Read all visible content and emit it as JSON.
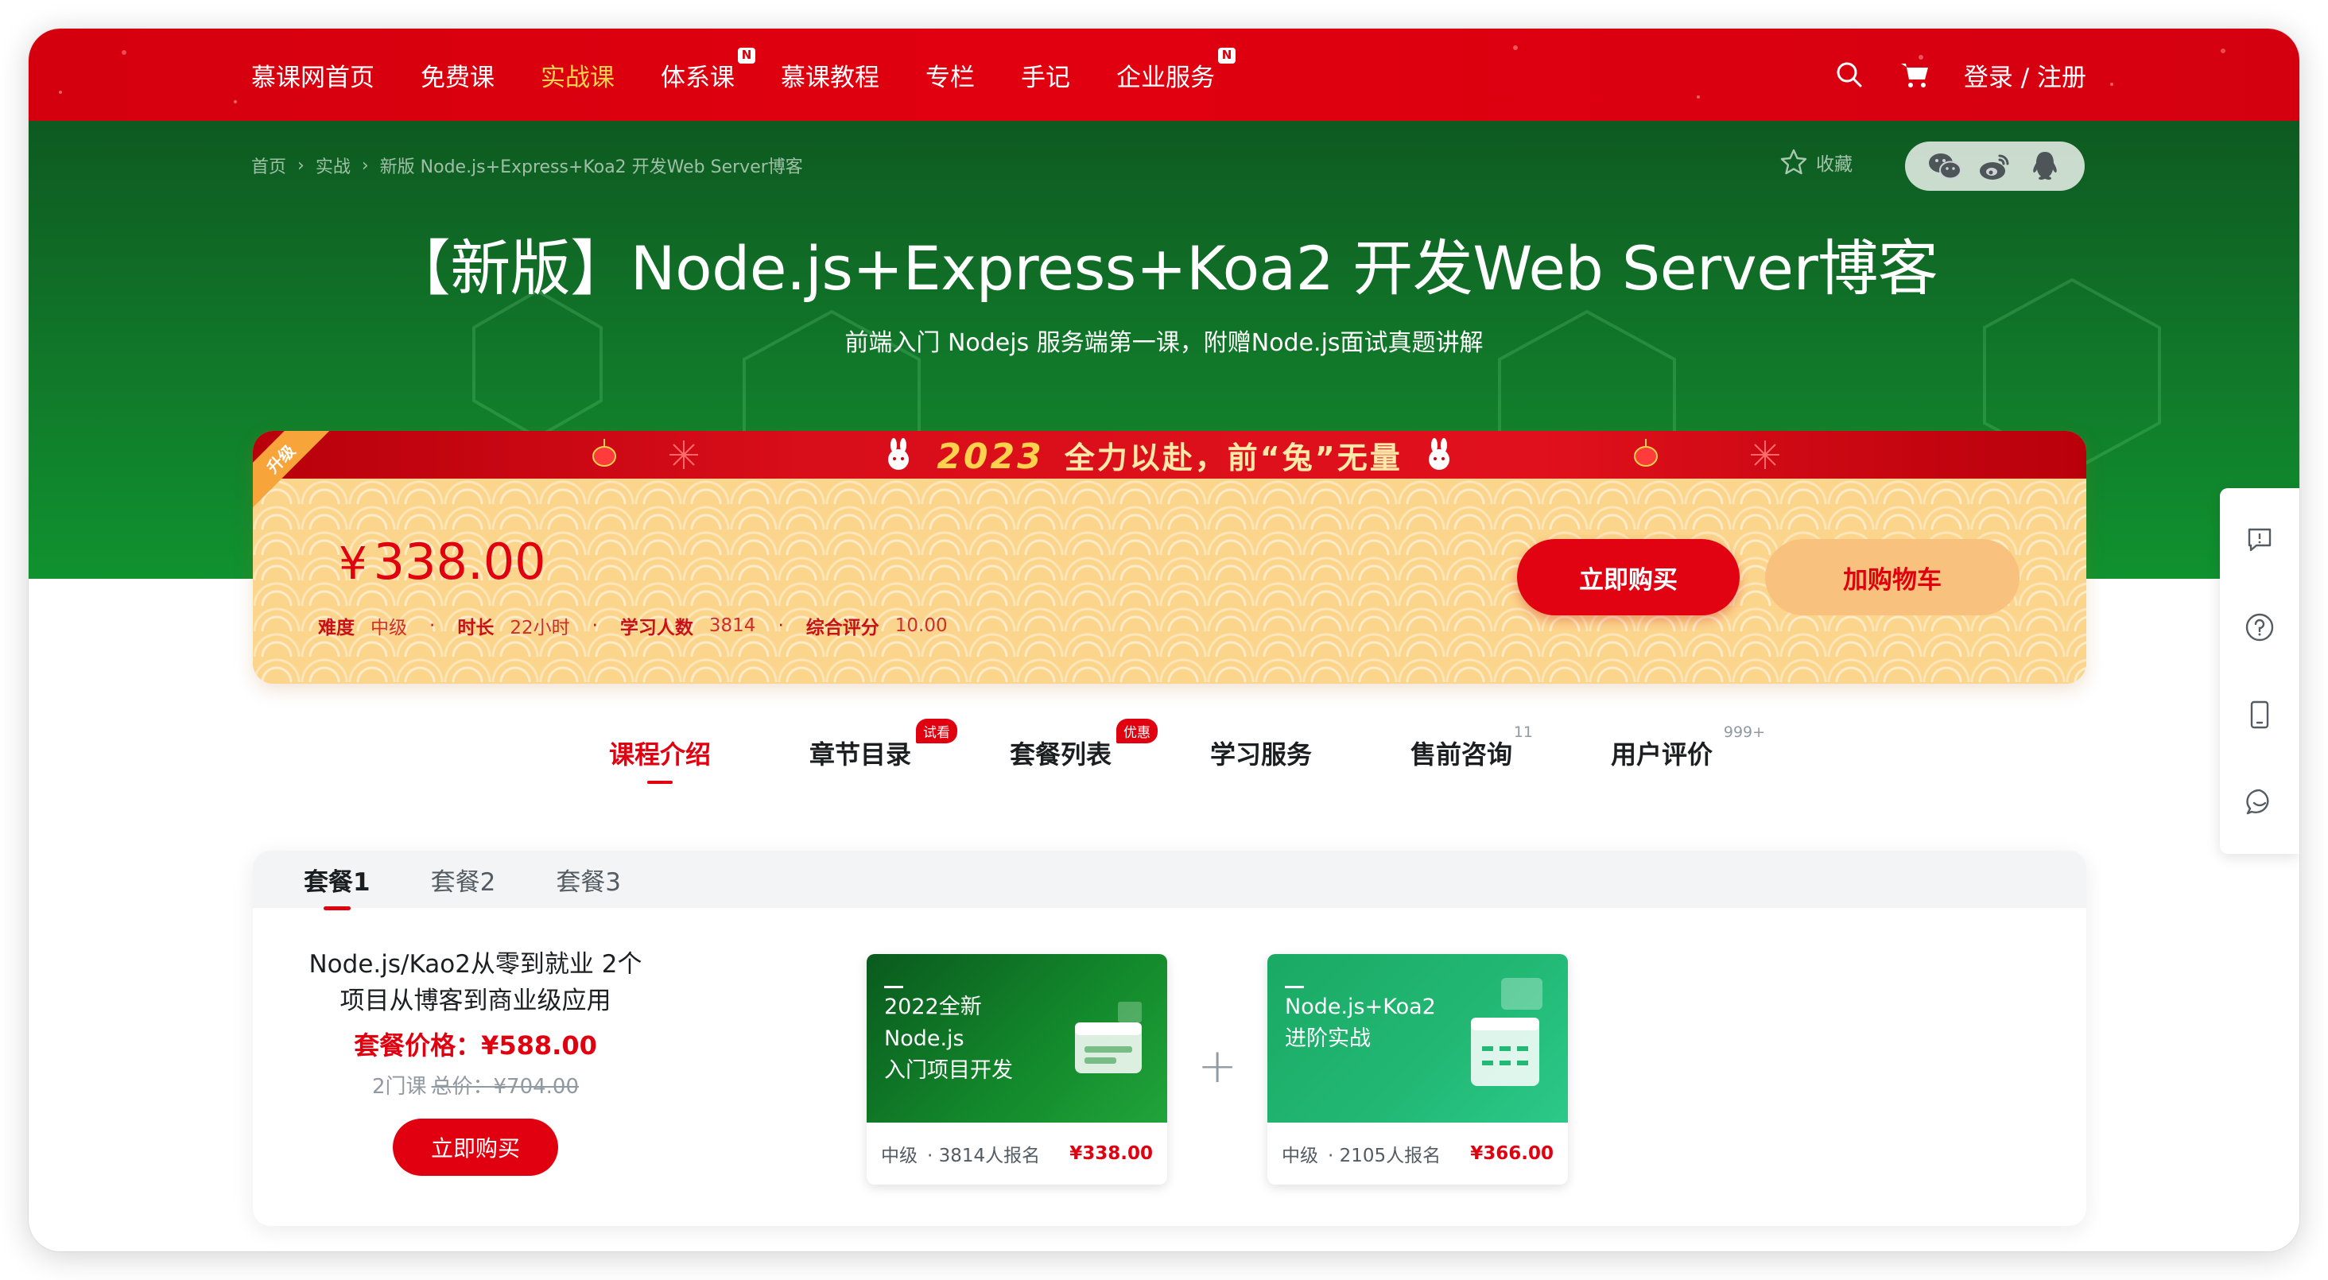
{
  "colors": {
    "brand_red": "#e0000f",
    "hero_green": "#11792a",
    "nav_red": "#d4000e",
    "price_gold": "#fcd48a",
    "active_nav": "#ffd24d"
  },
  "nav": {
    "links": [
      {
        "label": "慕课网首页",
        "badge": ""
      },
      {
        "label": "免费课",
        "badge": ""
      },
      {
        "label": "实战课",
        "badge": "",
        "active": true
      },
      {
        "label": "体系课",
        "badge": "N"
      },
      {
        "label": "慕课教程",
        "badge": ""
      },
      {
        "label": "专栏",
        "badge": ""
      },
      {
        "label": "手记",
        "badge": ""
      },
      {
        "label": "企业服务",
        "badge": "N"
      }
    ],
    "icons": [
      "search-icon",
      "cart-icon"
    ],
    "login_label": "登录 / 注册"
  },
  "breadcrumb": [
    "首页",
    "实战",
    "新版 Node.js+Express+Koa2 开发Web Server博客"
  ],
  "breadcrumb_sep": "›",
  "favorite_label": "收藏",
  "share_icons": [
    "wechat-icon",
    "weibo-icon",
    "qq-icon"
  ],
  "course": {
    "title": "【新版】Node.js+Express+Koa2 开发Web Server博客",
    "subtitle": "前端入门 Nodejs 服务端第一课，附赠Node.js面试真题讲解"
  },
  "promo": {
    "year": "2023",
    "slogan": "全力以赴，前“兔”无量",
    "ribbon": "升级"
  },
  "pricing": {
    "currency": "¥",
    "price": "338.00",
    "meta": [
      {
        "label": "难度",
        "value": "中级"
      },
      {
        "label": "时长",
        "value": "22小时"
      },
      {
        "label": "学习人数",
        "value": "3814"
      },
      {
        "label": "综合评分",
        "value": "10.00"
      }
    ],
    "meta_sep": "·",
    "buy_label": "立即购买",
    "cart_label": "加购物车"
  },
  "tabs": [
    {
      "label": "课程介绍",
      "active": true,
      "badge": "",
      "count": ""
    },
    {
      "label": "章节目录",
      "badge": "试看",
      "count": ""
    },
    {
      "label": "套餐列表",
      "badge": "优惠",
      "count": ""
    },
    {
      "label": "学习服务",
      "badge": "",
      "count": ""
    },
    {
      "label": "售前咨询",
      "badge": "",
      "count": "11"
    },
    {
      "label": "用户评价",
      "badge": "",
      "count": "999+"
    }
  ],
  "packages": {
    "tabs": [
      "套餐1",
      "套餐2",
      "套餐3"
    ],
    "name": "Node.js/Kao2从零到就业 2个项目从博客到商业级应用",
    "price_label": "套餐价格：¥588.00",
    "course_count": "2门课",
    "total_label": "总价：¥704.00",
    "buy_label": "立即购买",
    "plus": "+",
    "courses": [
      {
        "cover_text": "2022全新\nNode.js\n入门项目开发",
        "level": "中级",
        "enrolled": "· 3814人报名",
        "price": "¥338.00",
        "cover_color": "#138a2c"
      },
      {
        "cover_text": "Node.js+Koa2\n进阶实战",
        "level": "中级",
        "enrolled": "· 2105人报名",
        "price": "¥366.00",
        "cover_color": "#22b975"
      }
    ]
  },
  "sidebar_icons": [
    "feedback-icon",
    "help-icon",
    "mobile-icon",
    "chat-icon"
  ]
}
